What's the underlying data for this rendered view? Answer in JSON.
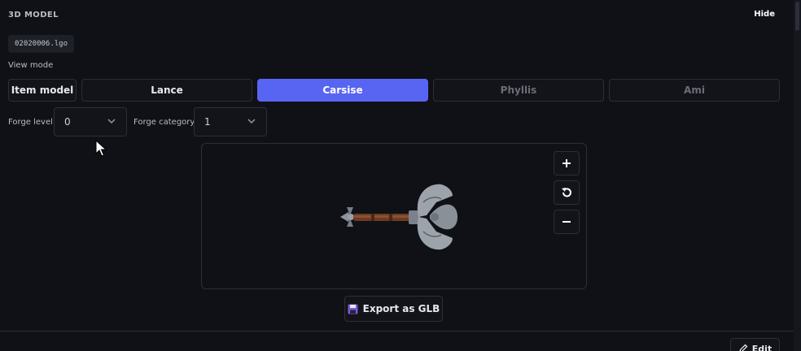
{
  "section": {
    "title": "3D MODEL",
    "hide_label": "Hide"
  },
  "file": {
    "name": "02020006.lgo"
  },
  "view_mode": {
    "label": "View mode",
    "buttons": [
      {
        "label": "Item model",
        "state": "normal"
      },
      {
        "label": "Lance",
        "state": "normal"
      },
      {
        "label": "Carsise",
        "state": "active"
      },
      {
        "label": "Phyllis",
        "state": "disabled"
      },
      {
        "label": "Ami",
        "state": "disabled"
      }
    ]
  },
  "forge": {
    "level_label": "Forge level",
    "level_value": "0",
    "category_label": "Forge category",
    "category_value": "1"
  },
  "viewer": {
    "model_icon": "double-bladed-axe",
    "zoom_in_icon": "plus-icon",
    "reset_icon": "rotate-reset-icon",
    "zoom_out_icon": "minus-icon"
  },
  "export": {
    "label": "Export as GLB",
    "icon": "floppy-disk-icon"
  },
  "footer": {
    "edit_label": "Edit",
    "edit_icon": "pencil-icon"
  },
  "colors": {
    "background": "#0f1117",
    "accent": "#5865f2",
    "border": "#2c2f38"
  }
}
